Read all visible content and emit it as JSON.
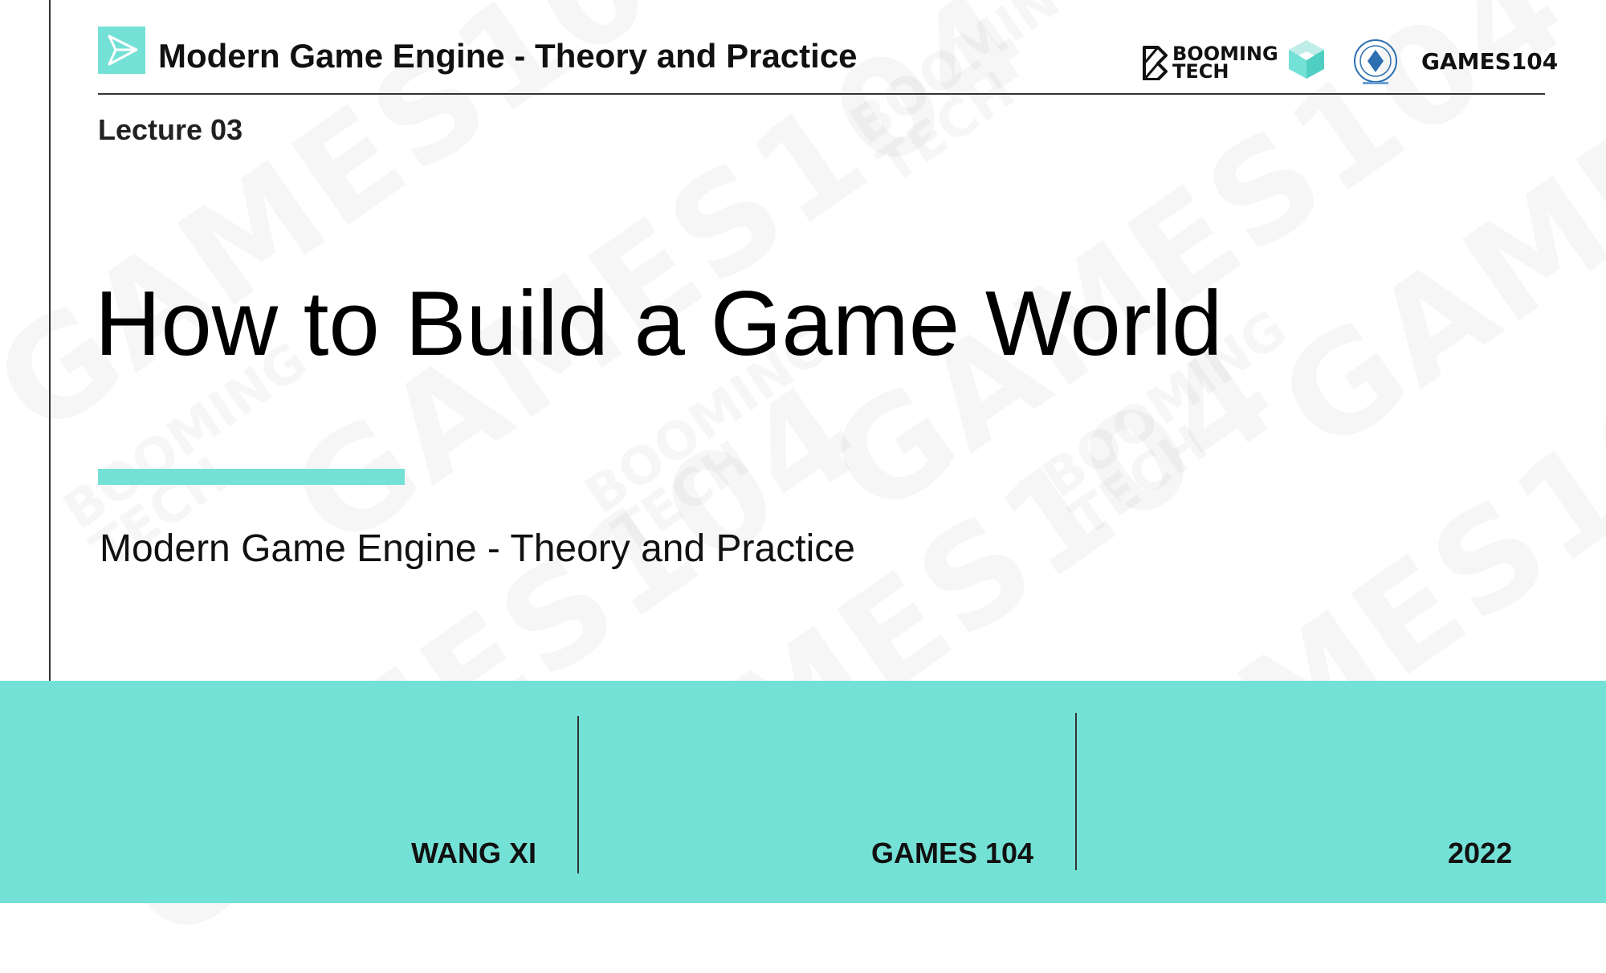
{
  "header": {
    "title": "Modern Game Engine - Theory and Practice",
    "logos": {
      "booming_line1": "BOOMING",
      "booming_line2": "TECH",
      "games": "GAMES104"
    }
  },
  "lecture": "Lecture 03",
  "main_title": "How to Build a Game World",
  "subtitle": "Modern Game Engine - Theory and Practice",
  "footer": {
    "author": "WANG XI",
    "course": "GAMES 104",
    "year": "2022"
  },
  "watermark": {
    "games": "GAMES104",
    "booming_line1": "BOOMING",
    "booming_line2": "TECH"
  },
  "colors": {
    "accent": "#74e1d6",
    "text": "#111111",
    "rule": "#333333"
  },
  "icons": {
    "header_logo": "paper-plane-icon",
    "cube_logo": "cube-icon",
    "seal_logo": "seal-icon"
  }
}
